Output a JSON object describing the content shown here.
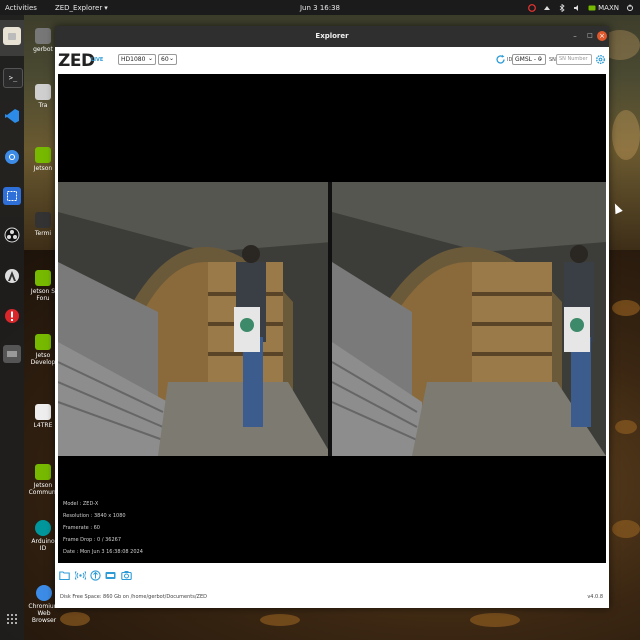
{
  "topbar": {
    "activities": "Activities",
    "app_menu": "ZED_Explorer",
    "clock": "Jun 3 16:38",
    "power_mode": "MAXN"
  },
  "desktop": {
    "icons": [
      {
        "label": "gerbot"
      },
      {
        "label": "Tra"
      },
      {
        "label": "Jetson"
      },
      {
        "label": "Termi"
      },
      {
        "label": "Jetson S Foru"
      },
      {
        "label": "Jetso Develop"
      },
      {
        "label": "L4TRE"
      },
      {
        "label": "Jetson Communi"
      },
      {
        "label": "Arduino ID"
      },
      {
        "label": "Chromium Web Browser"
      }
    ]
  },
  "window": {
    "title": "Explorer",
    "minimize": "–",
    "maximize": "□",
    "close": "×"
  },
  "toolbar": {
    "logo": "ZED",
    "live": "LIVE",
    "resolution": "HD1080",
    "fps": "60",
    "id_label": "ID",
    "id_value": "GMSL - 0",
    "sn_label": "SN",
    "sn_placeholder": "SN Number"
  },
  "camera_info": {
    "model": "Model : ZED-X",
    "resolution": "Resolution : 3840 x 1080",
    "framerate": "Framerate : 60",
    "frame_drop": "Frame Drop : 0 / 36267",
    "date": "Date : Mon Jun 3 16:38:08 2024"
  },
  "footer": {
    "disk_space": "Disk Free Space: 860 Gb  on /home/gerbot/Documents/ZED",
    "version": "v4.0.8"
  },
  "colors": {
    "accent": "#2c9bd6",
    "close_button": "#e0582b",
    "topbar": "#1b1b1b",
    "titlebar": "#2f2f2f"
  }
}
